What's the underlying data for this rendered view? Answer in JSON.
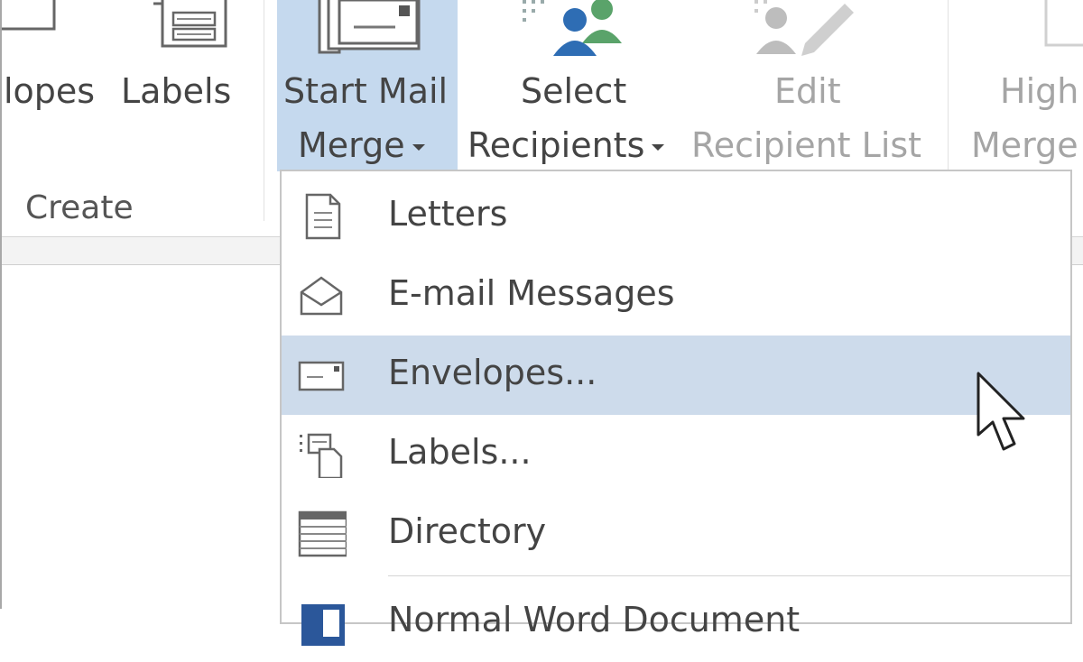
{
  "ribbon": {
    "envelopes_label": "lopes",
    "labels_label": "Labels",
    "create_group": "Create",
    "start_mail_merge_line1": "Start Mail",
    "start_mail_merge_line2": "Merge",
    "select_recipients_line1": "Select",
    "select_recipients_line2": "Recipients",
    "edit_recipient_list_line1": "Edit",
    "edit_recipient_list_line2": "Recipient List",
    "highlight_merge_line1": "High",
    "highlight_merge_line2": "Merge"
  },
  "menu": {
    "items": [
      {
        "label": "Letters",
        "icon": "letter-page-icon"
      },
      {
        "label": "E-mail Messages",
        "icon": "email-envelope-icon"
      },
      {
        "label": "Envelopes...",
        "icon": "envelope-icon"
      },
      {
        "label": "Labels...",
        "icon": "labels-icon"
      },
      {
        "label": "Directory",
        "icon": "directory-icon"
      },
      {
        "label": "Normal Word Document",
        "icon": "word-document-icon"
      }
    ],
    "hovered_item": "Envelopes..."
  },
  "colors": {
    "accent_highlight": "#c5d9ee",
    "menu_hover": "#cddbeb",
    "text": "#444444",
    "disabled_text": "#a5a5a5"
  }
}
